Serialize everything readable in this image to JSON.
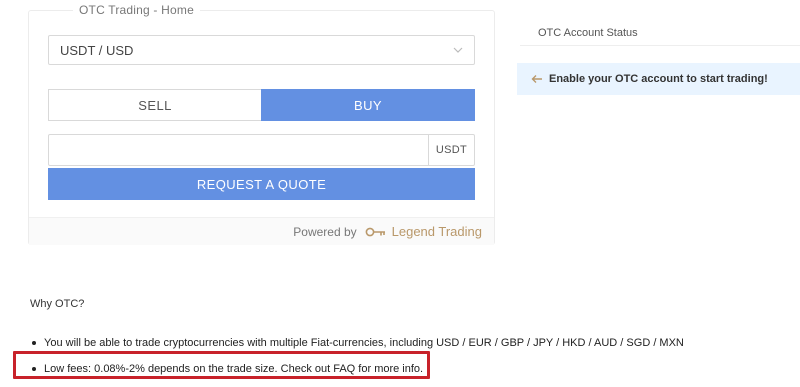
{
  "card": {
    "legend": "OTC Trading - Home",
    "pair_select": {
      "value": "USDT / USD",
      "icon": "chevron-down-icon"
    },
    "sides": {
      "sell_label": "SELL",
      "buy_label": "BUY",
      "active": "BUY"
    },
    "amount": {
      "value": "",
      "unit": "USDT"
    },
    "request_label": "REQUEST A QUOTE",
    "powered_by": {
      "prefix": "Powered by",
      "brand": "Legend Trading",
      "icon": "key-logo-icon"
    }
  },
  "status": {
    "header": "OTC Account Status",
    "banner_text": "Enable your OTC account to start trading!",
    "banner_icon": "arrow-left-icon"
  },
  "why": {
    "title": "Why OTC?",
    "items": [
      "You will be able to trade cryptocurrencies with multiple Fiat-currencies, including USD / EUR / GBP / JPY / HKD / AUD / SGD / MXN",
      "Low fees: 0.08%-2% depends on the trade size. Check out FAQ for more info."
    ]
  },
  "colors": {
    "primary": "#6390e2",
    "banner_bg": "#e9f4ff",
    "brand_gold": "#b9986a",
    "highlight_red": "#c8222a"
  }
}
